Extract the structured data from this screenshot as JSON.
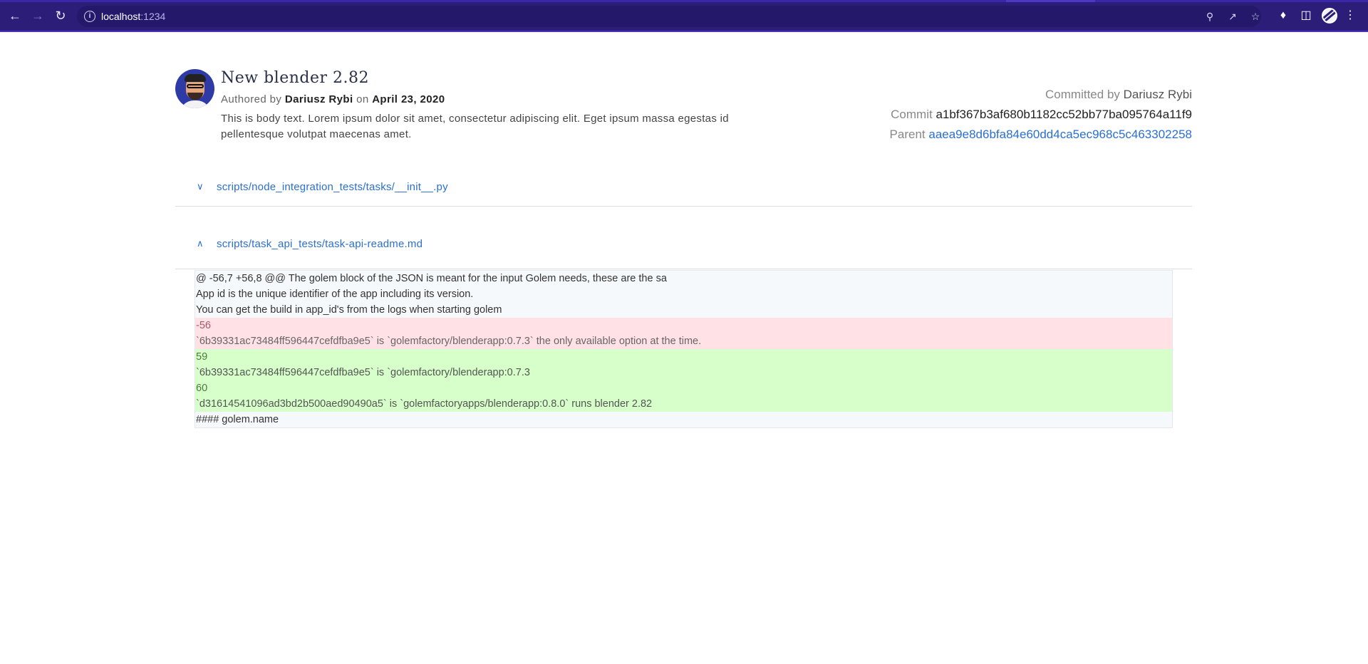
{
  "browser": {
    "url_host": "localhost",
    "url_port": ":1234"
  },
  "commit": {
    "title": "New blender 2.82",
    "authored_prefix": "Authored by",
    "author": "Dariusz Rybi",
    "date_prefix": "on",
    "date": "April 23, 2020",
    "body": "This is body text. Lorem ipsum dolor sit amet, consectetur adipiscing elit. Eget ipsum massa egestas id pellentesque volutpat maecenas amet.",
    "committed_by_label": "Committed by",
    "committer": "Dariusz Rybi",
    "commit_label": "Commit",
    "commit_hash": "a1bf367b3af680b1182cc52bb77ba095764a11f9",
    "parent_label": "Parent",
    "parent_hash": "aaea9e8d6bfa84e60dd4ca5ec968c5c463302258"
  },
  "files": [
    {
      "name": "scripts/node_integration_tests/tasks/__init__.py",
      "expanded": false
    },
    {
      "name": "scripts/task_api_tests/task-api-readme.md",
      "expanded": true
    }
  ],
  "diff": {
    "lines": [
      {
        "type": "context",
        "text": "@ -56,7 +56,8 @@ The golem block of the JSON is meant for the input Golem needs, these are the sa"
      },
      {
        "type": "context",
        "text": "App id is the unique identifier of the app including its version."
      },
      {
        "type": "context",
        "text": "You can get the build in app_id's from the logs when starting golem"
      },
      {
        "type": "del",
        "num": "-56"
      },
      {
        "type": "del",
        "text": "`6b39331ac73484ff596447cefdfba9e5` is `golemfactory/blenderapp:0.7.3` the only available option at the time."
      },
      {
        "type": "add",
        "num": "59"
      },
      {
        "type": "add",
        "text": "`6b39331ac73484ff596447cefdfba9e5` is `golemfactory/blenderapp:0.7.3"
      },
      {
        "type": "add",
        "num": "60"
      },
      {
        "type": "add",
        "text": "`d31614541096ad3bd2b500aed90490a5` is `golemfactoryapps/blenderapp:0.8.0` runs blender 2.82"
      },
      {
        "type": "context",
        "text": "#### golem.name"
      }
    ]
  },
  "colors": {
    "chrome_bg": "#2b1d78",
    "link": "#2a6fd1",
    "deletion_bg": "#ffe1e6",
    "addition_bg": "#d6ffc9"
  }
}
